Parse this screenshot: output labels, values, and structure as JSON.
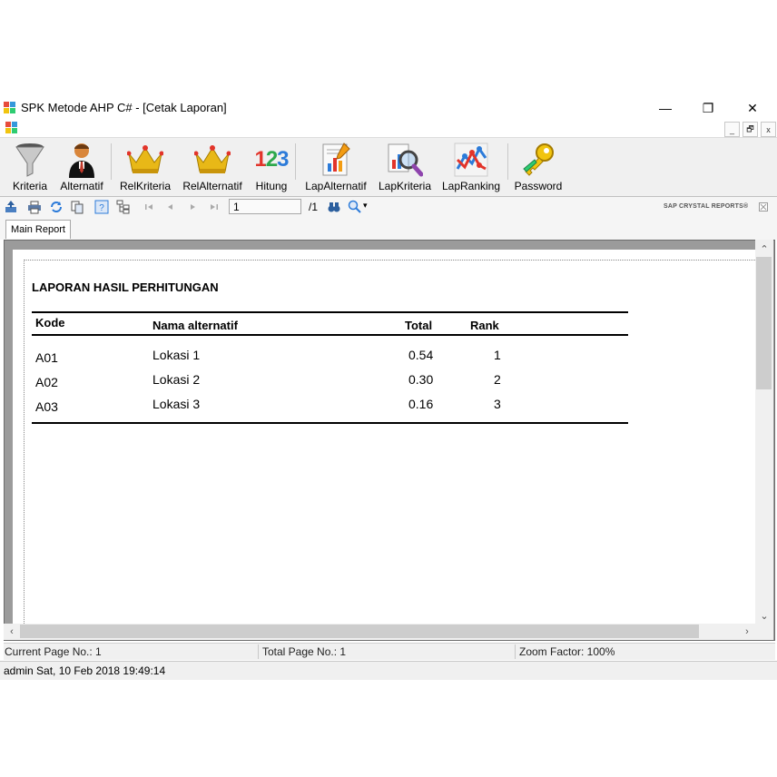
{
  "window": {
    "title": "SPK Metode AHP C# - [Cetak Laporan]",
    "minimize": "—",
    "restore": "❐",
    "close": "✕"
  },
  "mdi": {
    "minimize": "_",
    "restore": "🗗",
    "close": "x"
  },
  "menu": {
    "items": [
      {
        "label": "Kriteria",
        "icon": "funnel-icon"
      },
      {
        "label": "Alternatif",
        "icon": "user-icon"
      },
      {
        "label": "RelKriteria",
        "icon": "crown-icon"
      },
      {
        "label": "RelAlternatif",
        "icon": "crown-icon"
      },
      {
        "label": "Hitung",
        "icon": "numbers-123-icon"
      },
      {
        "label": "LapAlternatif",
        "icon": "report-chart-icon"
      },
      {
        "label": "LapKriteria",
        "icon": "report-search-icon"
      },
      {
        "label": "LapRanking",
        "icon": "line-chart-icon"
      },
      {
        "label": "Password",
        "icon": "keys-icon"
      }
    ],
    "hitung_glyph": "123"
  },
  "crystal": {
    "page_value": "1",
    "page_total": "/1",
    "brand": "SAP CRYSTAL REPORTS®",
    "tab_main": "Main Report"
  },
  "report": {
    "title": "LAPORAN HASIL PERHITUNGAN",
    "headers": {
      "kode": "Kode",
      "nama": "Nama alternatif",
      "total": "Total",
      "rank": "Rank"
    },
    "rows": [
      {
        "kode": "A01",
        "nama": "Lokasi 1",
        "total": "0.54",
        "rank": "1"
      },
      {
        "kode": "A02",
        "nama": "Lokasi 2",
        "total": "0.30",
        "rank": "2"
      },
      {
        "kode": "A03",
        "nama": "Lokasi 3",
        "total": "0.16",
        "rank": "3"
      }
    ]
  },
  "status": {
    "current_page": "Current Page No.: 1",
    "total_page": "Total Page No.: 1",
    "zoom": "Zoom Factor: 100%"
  },
  "bottom": {
    "text": "admin Sat, 10 Feb 2018 19:49:14"
  },
  "colors": {
    "gold": "#e8b817",
    "accent_red": "#e2342a",
    "accent_blue": "#2c7bd9"
  }
}
